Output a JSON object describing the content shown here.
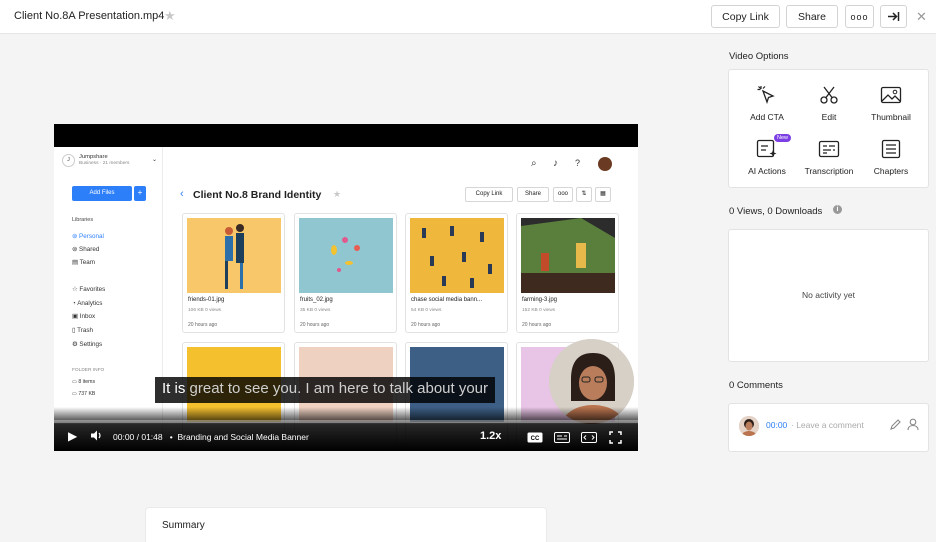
{
  "header": {
    "file_title": "Client No.8A Presentation.mp4",
    "copy_link_label": "Copy Link",
    "share_label": "Share",
    "more_label": "ooo",
    "star_icon": "star-icon",
    "exit_icon": "exit-panel-icon",
    "close_icon": "close-icon"
  },
  "video": {
    "subtitle_bright": "It is",
    "subtitle_dim": " great to see you. I am here to talk about your",
    "time": "00:00 / 01:48",
    "chapter_bullet": "•",
    "chapter": "Branding and Social Media Banner",
    "speed": "1.2x",
    "progress_fraction": 0.0,
    "inner_app": {
      "org_name": "Jumpshare",
      "org_sub": "Business · 21 members",
      "org_initial": "J",
      "add_files": "Add Files",
      "add_plus": "+",
      "libraries_header": "Libraries",
      "libraries": [
        "Personal",
        "Shared",
        "Team"
      ],
      "nav": [
        "Favorites",
        "Analytics",
        "Inbox",
        "Trash",
        "Settings"
      ],
      "folder_info_header": "FOLDER INFO",
      "folder_items": "8 items",
      "folder_size": "737 KB",
      "heading": "Client No.8 Brand Identity",
      "copy_link": "Copy Link",
      "share": "Share",
      "more": "ooo",
      "files": [
        {
          "name": "friends-01.jpg",
          "meta": "106 KB   0 views",
          "date": "20 hours ago",
          "color": "#f7c76a"
        },
        {
          "name": "fruits_02.jpg",
          "meta": "35 KB   0 views",
          "date": "20 hours ago",
          "color": "#8fc6d0"
        },
        {
          "name": "chase social media bann...",
          "meta": "54 KB   0 views",
          "date": "20 hours ago",
          "color": "#f0b73d"
        },
        {
          "name": "farming-3.jpg",
          "meta": "152 KB   0 views",
          "date": "20 hours ago",
          "color": "#5a7f3c"
        },
        {
          "name": "",
          "meta": "",
          "date": "",
          "color": "#f5c02e"
        },
        {
          "name": "",
          "meta": "",
          "date": "",
          "color": "#efd1c2"
        },
        {
          "name": "",
          "meta": "",
          "date": "",
          "color": "#3d5f86"
        },
        {
          "name": "",
          "meta": "",
          "date": "",
          "color": "#e8c4e6"
        }
      ]
    }
  },
  "summary": {
    "title": "Summary"
  },
  "right_panel": {
    "video_options_label": "Video Options",
    "options": [
      {
        "label": "Add CTA",
        "icon": "cursor-click-icon"
      },
      {
        "label": "Edit",
        "icon": "scissors-icon"
      },
      {
        "label": "Thumbnail",
        "icon": "image-icon"
      },
      {
        "label": "AI Actions",
        "icon": "ai-actions-icon",
        "badge": "New"
      },
      {
        "label": "Transcription",
        "icon": "transcript-icon"
      },
      {
        "label": "Chapters",
        "icon": "chapters-icon"
      }
    ],
    "views_label": "0 Views, 0 Downloads",
    "info_icon": "info-icon",
    "no_activity": "No activity yet",
    "comments_label": "0 Comments",
    "comment_time": "00:00",
    "comment_placeholder": " · Leave a comment"
  },
  "colors": {
    "accent": "#2d7ff9",
    "badge": "#7b3fe4"
  }
}
